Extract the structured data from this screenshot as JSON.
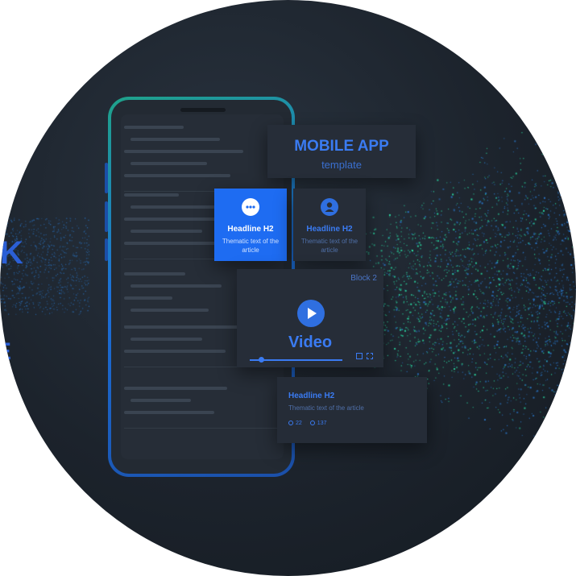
{
  "title_card": {
    "main": "MOBILE APP",
    "sub": "template"
  },
  "tiles": [
    {
      "icon": "chat-bubble-icon",
      "headline": "Headline H2",
      "text": "Thematic text of the article"
    },
    {
      "icon": "user-icon",
      "headline": "Headline H2",
      "text": "Thematic text of the article"
    }
  ],
  "video_card": {
    "block_label": "Block 2",
    "title": "Video",
    "progress": 0.12
  },
  "article_card": {
    "headline": "Headline H2",
    "text": "Thematic text of the article",
    "likes": "22",
    "views": "137"
  },
  "side_letters": [
    "K",
    "E"
  ],
  "colors": {
    "background": "#1c232c",
    "accent_blue": "#3a7bf2",
    "tile_blue": "#1e6cf2",
    "particle_green": "#2ad6a0",
    "particle_blue": "#2b7fd8"
  }
}
